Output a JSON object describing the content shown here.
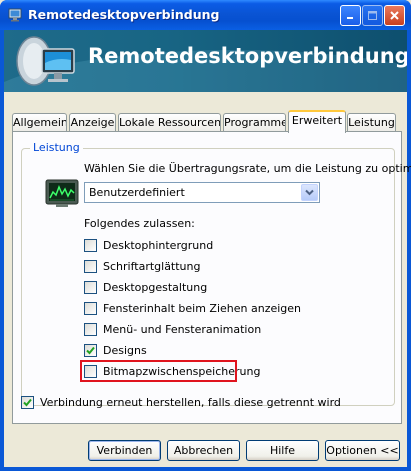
{
  "window": {
    "title": "Remotedesktopverbindung",
    "controls": {
      "minimize": "minimize",
      "maximize": "maximize",
      "close": "close"
    }
  },
  "banner": {
    "title": "Remotedesktopverbindung"
  },
  "tabs": [
    {
      "label": "Allgemein",
      "active": false
    },
    {
      "label": "Anzeige",
      "active": false
    },
    {
      "label": "Lokale Ressourcen",
      "active": false
    },
    {
      "label": "Programme",
      "active": false
    },
    {
      "label": "Erweitert",
      "active": true
    },
    {
      "label": "Leistung",
      "active": false
    }
  ],
  "performance": {
    "group_label": "Leistung",
    "description": "Wählen Sie die Übertragungsrate, um die Leistung zu optimieren.",
    "speed_select": {
      "value": "Benutzerdefiniert"
    },
    "allow_label": "Folgendes zulassen:",
    "options": [
      {
        "label": "Desktophintergrund",
        "checked": false
      },
      {
        "label": "Schriftartglättung",
        "checked": false
      },
      {
        "label": "Desktopgestaltung",
        "checked": false
      },
      {
        "label": "Fensterinhalt beim Ziehen anzeigen",
        "checked": false
      },
      {
        "label": "Menü- und Fensteranimation",
        "checked": false
      },
      {
        "label": "Designs",
        "checked": true
      },
      {
        "label": "Bitmapzwischenspeicherung",
        "checked": false,
        "highlighted": true
      }
    ]
  },
  "reconnect": {
    "label": "Verbindung erneut herstellen, falls diese getrennt wird",
    "checked": true
  },
  "buttons": {
    "connect": "Verbinden",
    "cancel": "Abbrechen",
    "help": "Hilfe",
    "options": "Optionen <<"
  },
  "colors": {
    "highlight": "#e0141e",
    "group_label": "#0046d5",
    "titlebar": "#0a54d4"
  }
}
